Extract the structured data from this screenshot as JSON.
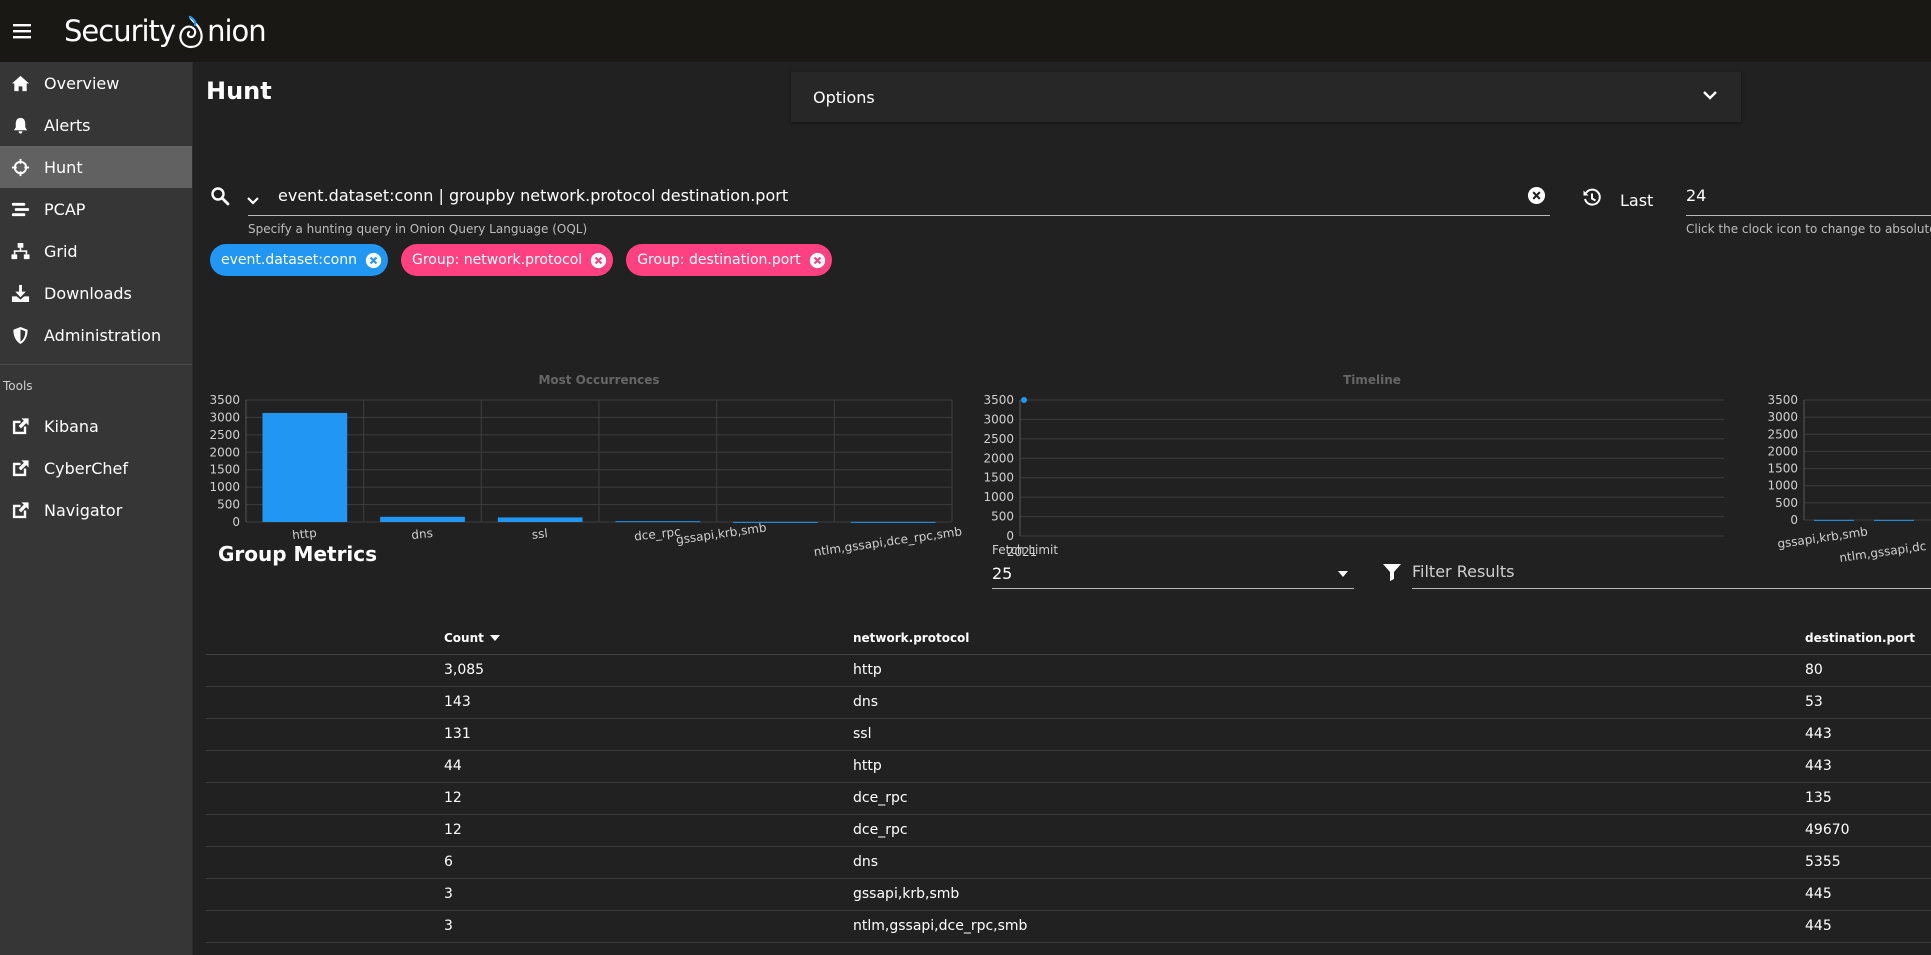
{
  "app": {
    "logo_part1": "Security",
    "logo_part2": "nion"
  },
  "sidebar": {
    "items": [
      {
        "label": "Overview",
        "icon": "home-icon"
      },
      {
        "label": "Alerts",
        "icon": "bell-icon"
      },
      {
        "label": "Hunt",
        "icon": "crosshairs-icon",
        "active": true
      },
      {
        "label": "PCAP",
        "icon": "stream-icon"
      },
      {
        "label": "Grid",
        "icon": "network-icon"
      },
      {
        "label": "Downloads",
        "icon": "download-icon"
      },
      {
        "label": "Administration",
        "icon": "shield-icon"
      }
    ],
    "tools_header": "Tools",
    "tools": [
      {
        "label": "Kibana",
        "icon": "external-link-icon"
      },
      {
        "label": "CyberChef",
        "icon": "external-link-icon"
      },
      {
        "label": "Navigator",
        "icon": "external-link-icon"
      }
    ]
  },
  "main": {
    "page_title": "Hunt",
    "options_label": "Options"
  },
  "search": {
    "query": "event.dataset:conn | groupby network.protocol destination.port",
    "hint": "Specify a hunting query in Onion Query Language (OQL)",
    "last_label": "Last",
    "last_value": "24",
    "last_hint": "Click the clock icon to change to absolute"
  },
  "chips": [
    {
      "label": "event.dataset:conn",
      "color": "#2196f3"
    },
    {
      "label": "Group: network.protocol",
      "color": "#ff4081"
    },
    {
      "label": "Group: destination.port",
      "color": "#ff4081"
    }
  ],
  "chart_data": [
    {
      "type": "bar",
      "title": "Most Occurrences",
      "categories": [
        "http",
        "dns",
        "ssl",
        "dce_rpc",
        "gssapi,krb,smb",
        "ntlm,gssapi,dce_rpc,smb"
      ],
      "values": [
        3129,
        149,
        131,
        24,
        3,
        3
      ],
      "y_ticks": [
        0,
        500,
        1000,
        1500,
        2000,
        2500,
        3000,
        3500
      ],
      "ylim": [
        0,
        3500
      ],
      "color": "#2196f3",
      "grid": true
    },
    {
      "type": "line",
      "title": "Timeline",
      "x": [
        "2021"
      ],
      "values": [
        3500
      ],
      "y_ticks": [
        0,
        500,
        1000,
        1500,
        2000,
        2500,
        3000,
        3500
      ],
      "ylim": [
        0,
        3500
      ],
      "color": "#2196f3",
      "grid": true
    },
    {
      "type": "bar",
      "title": "",
      "categories": [
        "gssapi,krb,smb",
        "ntlm,gssapi,dc"
      ],
      "values": [
        3,
        3
      ],
      "y_ticks": [
        0,
        500,
        1000,
        1500,
        2000,
        2500,
        3000,
        3500
      ],
      "ylim": [
        0,
        3500
      ],
      "color": "#2196f3",
      "grid": true
    }
  ],
  "metrics": {
    "title": "Group Metrics",
    "fetch_limit_label": "Fetch Limit",
    "fetch_limit_value": "25",
    "filter_placeholder": "Filter Results",
    "columns": [
      "Count",
      "network.protocol",
      "destination.port"
    ],
    "rows": [
      {
        "count": "3,085",
        "protocol": "http",
        "port": "80"
      },
      {
        "count": "143",
        "protocol": "dns",
        "port": "53"
      },
      {
        "count": "131",
        "protocol": "ssl",
        "port": "443"
      },
      {
        "count": "44",
        "protocol": "http",
        "port": "443"
      },
      {
        "count": "12",
        "protocol": "dce_rpc",
        "port": "135"
      },
      {
        "count": "12",
        "protocol": "dce_rpc",
        "port": "49670"
      },
      {
        "count": "6",
        "protocol": "dns",
        "port": "5355"
      },
      {
        "count": "3",
        "protocol": "gssapi,krb,smb",
        "port": "445"
      },
      {
        "count": "3",
        "protocol": "ntlm,gssapi,dce_rpc,smb",
        "port": "445"
      }
    ]
  }
}
